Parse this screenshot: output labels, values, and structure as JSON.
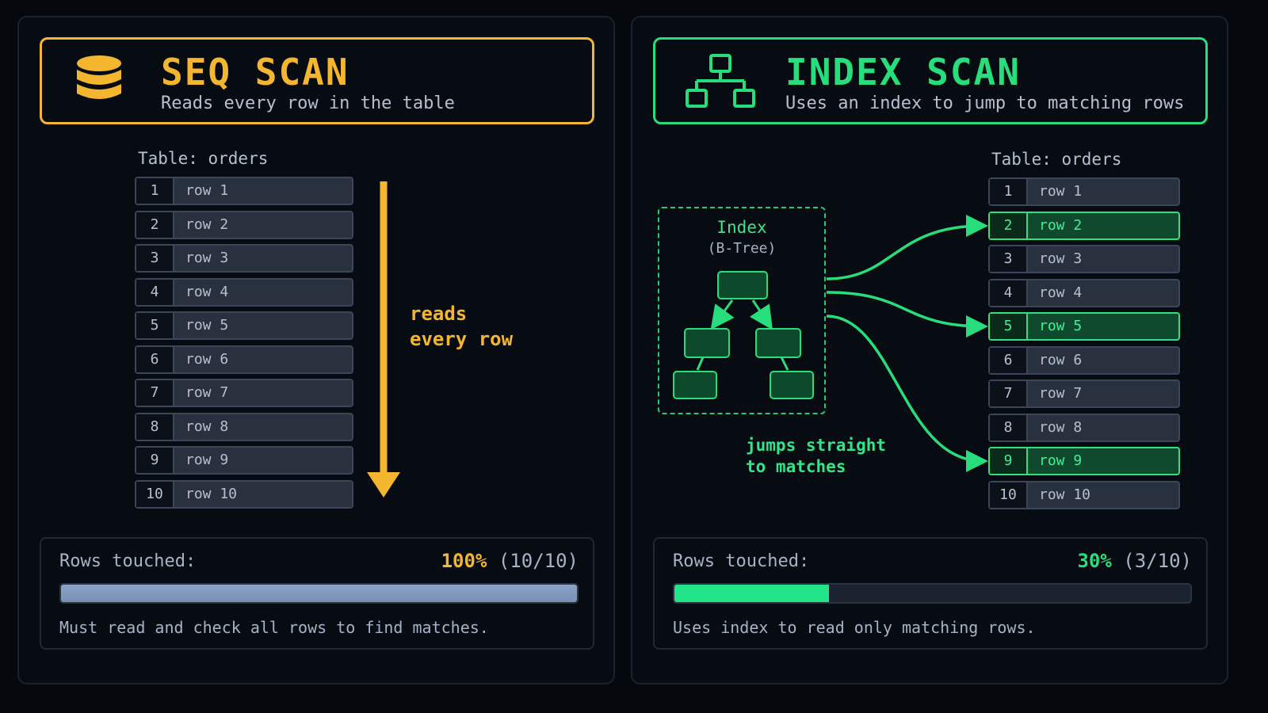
{
  "colors": {
    "seq_accent": "#f4b52f",
    "index_accent": "#28dd7c",
    "background": "#05080d",
    "row_bg": "#29313f",
    "match_bg": "#0f4a2e"
  },
  "seq": {
    "title": "SEQ SCAN",
    "subtitle": "Reads every row in the table",
    "icon": "database-icon",
    "table_label": "Table: orders",
    "rows": [
      {
        "num": "1",
        "name": "row 1"
      },
      {
        "num": "2",
        "name": "row 2"
      },
      {
        "num": "3",
        "name": "row 3"
      },
      {
        "num": "4",
        "name": "row 4"
      },
      {
        "num": "5",
        "name": "row 5"
      },
      {
        "num": "6",
        "name": "row 6"
      },
      {
        "num": "7",
        "name": "row 7"
      },
      {
        "num": "8",
        "name": "row 8"
      },
      {
        "num": "9",
        "name": "row 9"
      },
      {
        "num": "10",
        "name": "row 10"
      }
    ],
    "annotation": "reads\nevery row",
    "stats": {
      "label": "Rows touched:",
      "percent": "100%",
      "fraction": "(10/10)",
      "progress": 1.0,
      "note": "Must read and check all rows to find matches."
    }
  },
  "index": {
    "title": "INDEX SCAN",
    "subtitle": "Uses an index to jump to matching rows",
    "icon": "tree-structure-icon",
    "table_label": "Table: orders",
    "index_title": "Index",
    "index_subtitle": "(B-Tree)",
    "rows": [
      {
        "num": "1",
        "name": "row 1",
        "match": false
      },
      {
        "num": "2",
        "name": "row 2",
        "match": true
      },
      {
        "num": "3",
        "name": "row 3",
        "match": false
      },
      {
        "num": "4",
        "name": "row 4",
        "match": false
      },
      {
        "num": "5",
        "name": "row 5",
        "match": true
      },
      {
        "num": "6",
        "name": "row 6",
        "match": false
      },
      {
        "num": "7",
        "name": "row 7",
        "match": false
      },
      {
        "num": "8",
        "name": "row 8",
        "match": false
      },
      {
        "num": "9",
        "name": "row 9",
        "match": true
      },
      {
        "num": "10",
        "name": "row 10",
        "match": false
      }
    ],
    "annotation": "jumps straight\nto matches",
    "stats": {
      "label": "Rows touched:",
      "percent": "30%",
      "fraction": "(3/10)",
      "progress": 0.3,
      "note": "Uses index to read only matching rows."
    }
  }
}
